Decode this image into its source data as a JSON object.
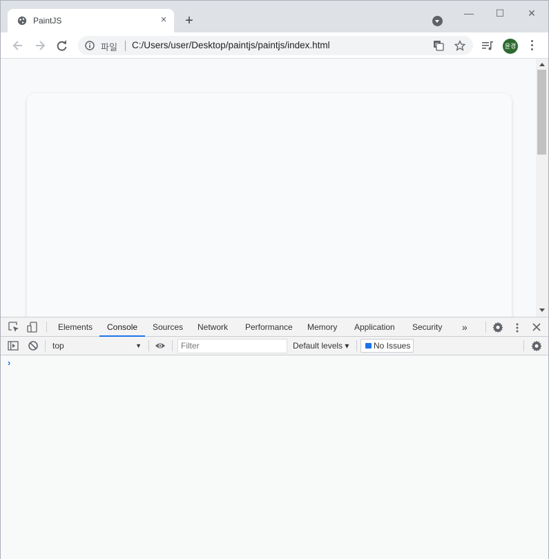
{
  "browser": {
    "tab": {
      "title": "PaintJS",
      "favicon": "globe-icon",
      "close": "×"
    },
    "new_tab": "+",
    "window_controls": {
      "minimize": "—",
      "maximize": "☐",
      "close": "✕"
    },
    "address": {
      "scheme_label": "파일",
      "url": "C:/Users/user/Desktop/paintjs/paintjs/index.html"
    },
    "profile_initials": "윤경"
  },
  "devtools": {
    "tabs": [
      "Elements",
      "Console",
      "Sources",
      "Network",
      "Performance",
      "Memory",
      "Application",
      "Security"
    ],
    "active_tab": "Console",
    "more_tabs": "»",
    "context": "top",
    "filter_placeholder": "Filter",
    "levels": "Default levels ▾",
    "issues": "No Issues",
    "prompt": "›"
  },
  "colors": {
    "accent": "#1a73e8",
    "avatar": "#2d6a2f",
    "page_bg": "#f7f9fa"
  }
}
